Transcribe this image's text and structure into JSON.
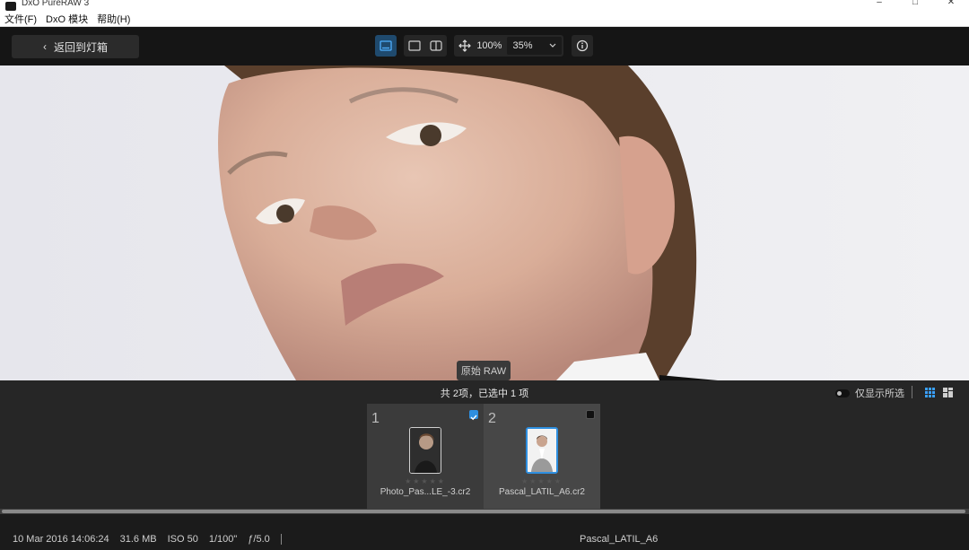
{
  "window": {
    "title": "DxO PureRAW 3",
    "controls": [
      "–",
      "□",
      "✕"
    ]
  },
  "menu": {
    "items": [
      "文件(F)",
      "DxO 模块",
      "帮助(H)"
    ]
  },
  "toolbar": {
    "back_label": "返回到灯箱",
    "zoom_fit_label": "100%",
    "zoom_value": "35%"
  },
  "viewer": {
    "raw_tag": "原始 RAW"
  },
  "filmstrip": {
    "selection_info": "共 2项，已选中 1 项",
    "show_selected_label": "仅显示所选",
    "thumbnails": [
      {
        "number": "1",
        "filename": "Photo_Pas...LE_-3.cr2",
        "checked": true,
        "stars": "★★★★★"
      },
      {
        "number": "2",
        "filename": "Pascal_LATIL_A6.cr2",
        "checked": false,
        "stars": "★★★★★"
      }
    ]
  },
  "status": {
    "date": "10 Mar 2016 14:06:24",
    "size": "31.6 MB",
    "iso": "ISO 50",
    "shutter": "1/100\"",
    "aperture": "ƒ/5.0",
    "current_name": "Pascal_LATIL_A6"
  },
  "colors": {
    "accent": "#2e8fe0",
    "toolbar_bg": "#151515",
    "filmstrip_bg": "#262626"
  }
}
